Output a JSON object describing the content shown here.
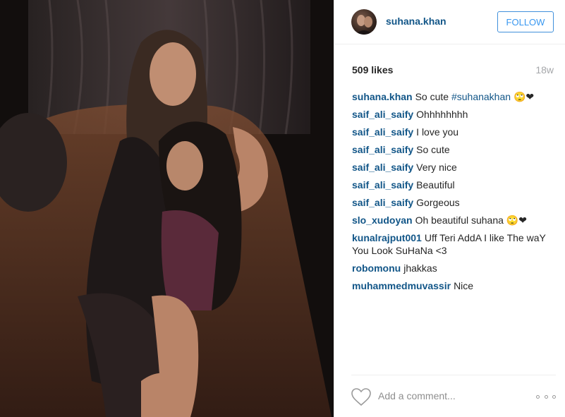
{
  "post": {
    "username": "suhana.khan",
    "follow_label": "FOLLOW",
    "likes": "509 likes",
    "time": "18w",
    "caption": {
      "user": "suhana.khan",
      "text": "So cute",
      "hashtag": "#suhanakhan",
      "emoji": "🙄❤"
    }
  },
  "comments": [
    {
      "user": "saif_ali_saify",
      "text": "Ohhhhhhhh"
    },
    {
      "user": "saif_ali_saify",
      "text": "I love you"
    },
    {
      "user": "saif_ali_saify",
      "text": "So cute"
    },
    {
      "user": "saif_ali_saify",
      "text": "Very nice"
    },
    {
      "user": "saif_ali_saify",
      "text": "Beautiful"
    },
    {
      "user": "saif_ali_saify",
      "text": "Gorgeous"
    },
    {
      "user": "slo_xudoyan",
      "text": "Oh beautiful suhana 🙄❤"
    },
    {
      "user": "kunalrajput001",
      "text": "Uff Teri AddA I like The waY You Look SuHaNa <3"
    },
    {
      "user": "robomonu",
      "text": "jhakkas"
    },
    {
      "user": "muhammedmuvassir",
      "text": "Nice"
    }
  ],
  "footer": {
    "comment_placeholder": "Add a comment...",
    "like_icon": "heart-outline-icon",
    "more_icon": "more-options-icon"
  },
  "colors": {
    "link": "#125688",
    "follow_blue": "#3897f0",
    "muted": "#a5a7aa"
  }
}
